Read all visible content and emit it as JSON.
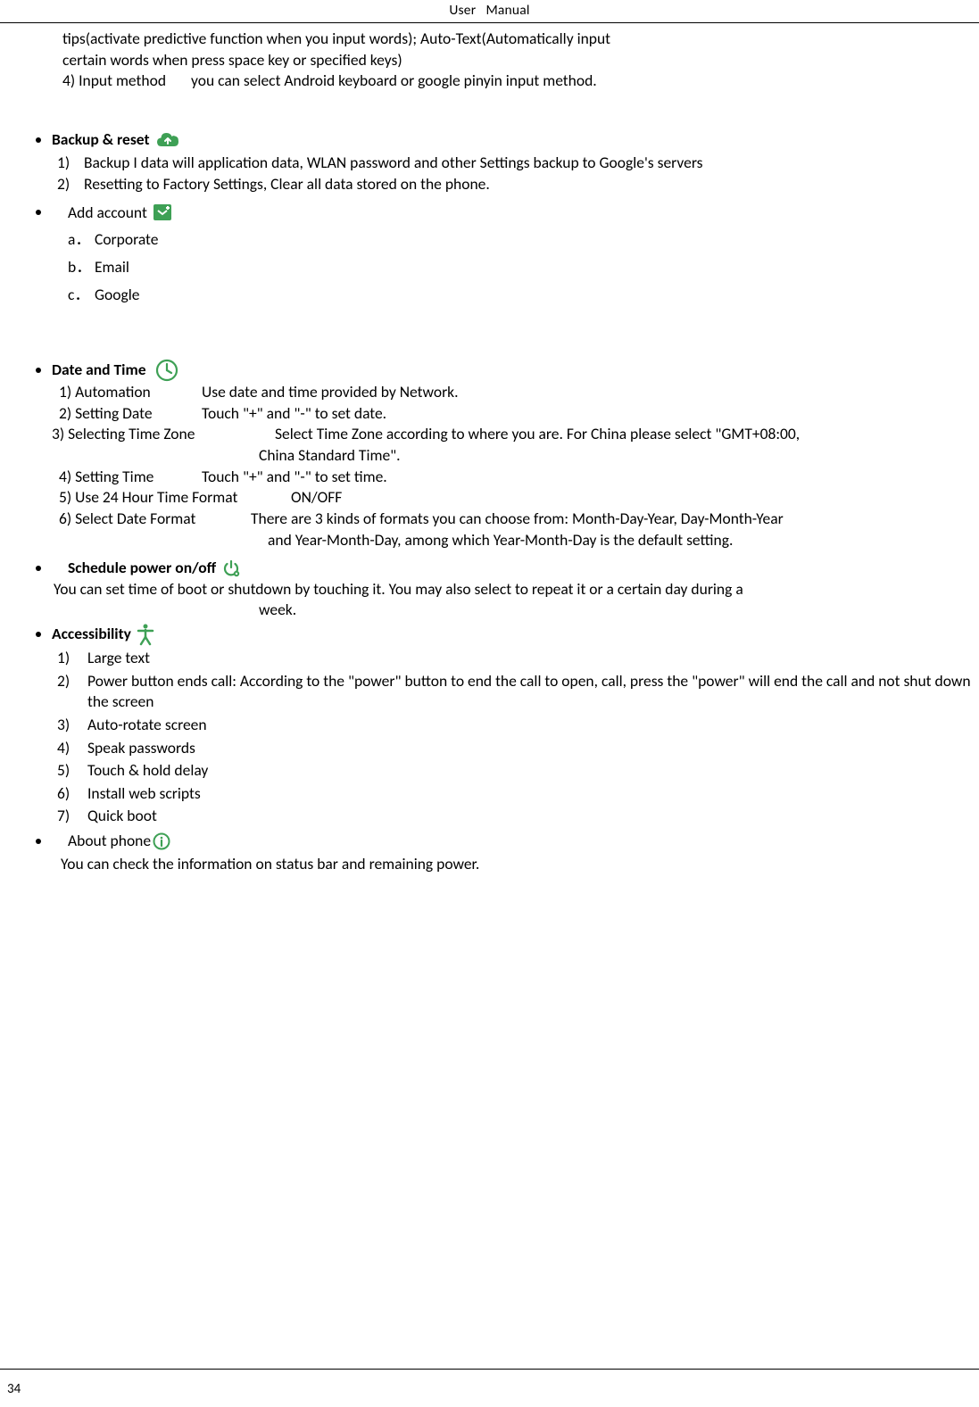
{
  "header": {
    "title_a": "User",
    "title_b": "Manual"
  },
  "intro": {
    "line1": "tips(activate predictive function when you input words); Auto-Text(Automatically input",
    "line2": "certain words when press space key or specified keys)",
    "line3_lbl": "4) Input method",
    "line3_txt": "you can select Android keyboard or google pinyin input method."
  },
  "backup": {
    "title": "Backup & reset",
    "items": [
      {
        "n": "1)",
        "t": "Backup I data will application data, WLAN password and other Settings backup to Google's servers"
      },
      {
        "n": "2)",
        "t": "Resetting to Factory Settings, Clear all data stored on the phone."
      }
    ]
  },
  "addacc": {
    "title": "Add account",
    "items": [
      {
        "n": "a．",
        "t": "Corporate"
      },
      {
        "n": "b．",
        "t": "Email"
      },
      {
        "n": "c．",
        "t": "Google"
      }
    ]
  },
  "datetime": {
    "title": "Date and Time",
    "r1_lbl": "1) Automation",
    "r1_txt": "Use date and time provided by Network.",
    "r2_lbl": "2) Setting Date",
    "r2_txt": "Touch \"+\" and \"-\" to set date.",
    "r3_lbl": "3) Selecting Time Zone",
    "r3_txt": "Select Time Zone according to where you are. For China please select \"GMT+08:00,",
    "r3_cont": "China Standard Time\".",
    "r4_lbl": "4) Setting Time",
    "r4_txt": "Touch \"+\" and \"-\" to set time.",
    "r5_lbl": "5) Use 24 Hour Time Format",
    "r5_txt": "ON/OFF",
    "r6_lbl": "6) Select Date Format",
    "r6_txt": "There are 3 kinds of formats you can choose from: Month-Day-Year, Day-Month-Year",
    "r6_cont": "and Year-Month-Day, among which Year-Month-Day is the default setting."
  },
  "schedule": {
    "title": "Schedule power on/off",
    "desc1": "You can set time of boot or shutdown by touching it. You may also select to repeat it or a certain day during a",
    "desc2": "week."
  },
  "accessibility": {
    "title": "Accessibility",
    "items": [
      {
        "n": "1)",
        "t": "Large text"
      },
      {
        "n": "2)",
        "t_pre": "Power button ends call: ",
        "t": "According to the \"power\" button to end the call to open, call, press the \"power\" will end the call and not shut down the screen"
      },
      {
        "n": "3)",
        "t": "Auto-rotate screen"
      },
      {
        "n": "4)",
        "t": "Speak passwords"
      },
      {
        "n": "5)",
        "t": "Touch & hold delay"
      },
      {
        "n": "6)",
        "t": "Install web scripts"
      },
      {
        "n": "7)",
        "t": "Quick boot"
      }
    ]
  },
  "about": {
    "title": "About phone",
    "desc": "You can check the information on status bar and remaining power."
  },
  "footer": {
    "page": "34"
  }
}
